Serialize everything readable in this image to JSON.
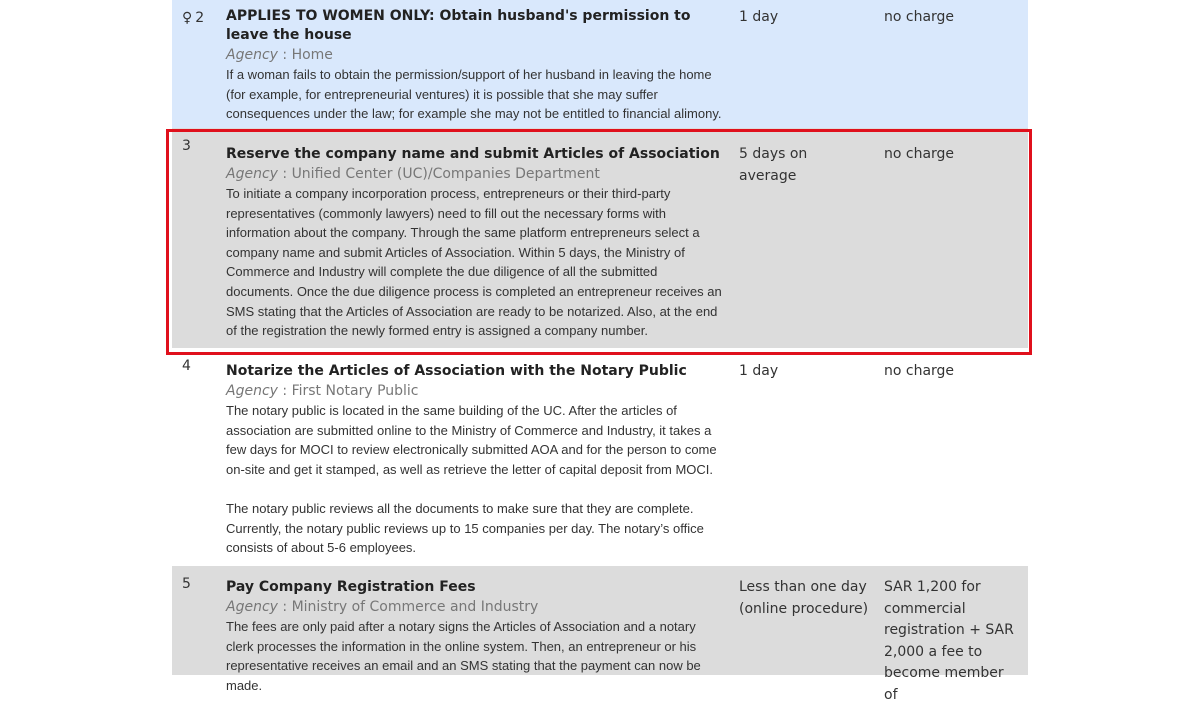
{
  "procedures": [
    {
      "number": "2",
      "women_icon": "♀",
      "title": "APPLIES TO WOMEN ONLY: Obtain husband's permission to leave the house",
      "agency_label": "Agency",
      "agency_sep": " : ",
      "agency": "Home",
      "description": [
        "If a woman fails to obtain the permission/support of her husband in leaving the home (for example, for entrepreneurial ventures) it is possible that she may suffer consequences under the law; for example she may not be entitled to financial alimony."
      ],
      "time": "1 day",
      "cost": "no charge"
    },
    {
      "number": "3",
      "title": "Reserve the company name and submit Articles of Association",
      "agency_label": "Agency",
      "agency_sep": " : ",
      "agency": "Unified Center (UC)/Companies Department",
      "description": [
        "To initiate a company incorporation process, entrepreneurs or their third-party representatives (commonly lawyers) need to fill out the necessary forms with information about the company. Through the same platform entrepreneurs select a company name and submit Articles of Association. Within 5 days, the Ministry of Commerce and Industry will complete the due diligence of all the submitted documents. Once the due diligence process is completed an entrepreneur receives an SMS stating that the Articles of Association are ready to be notarized. Also, at the end of the registration the newly formed entry is assigned a company number."
      ],
      "time": "5 days on average",
      "cost": "no charge"
    },
    {
      "number": "4",
      "title": "Notarize the Articles of Association with the Notary Public",
      "agency_label": "Agency",
      "agency_sep": " : ",
      "agency": "First Notary Public",
      "description": [
        "The notary public is located in the same building of the UC. After the articles of association are submitted online to the Ministry of Commerce and Industry, it takes a few days for MOCI to review electronically submitted AOA and for the person to come on-site and get it stamped, as well as retrieve the letter of capital deposit from MOCI.",
        "The notary public reviews all the documents to make sure that they are complete. Currently, the notary public reviews up to 15 companies per day. The notary’s office consists of about 5-6 employees."
      ],
      "time": "1 day",
      "cost": "no charge"
    },
    {
      "number": "5",
      "title": "Pay Company Registration Fees",
      "agency_label": "Agency",
      "agency_sep": " : ",
      "agency": "Ministry of Commerce and Industry",
      "description": [
        "The fees are only paid after a notary signs the Articles of Association and a notary clerk processes the information in the online system. Then, an entrepreneur or his representative receives an email and an SMS stating that the payment can now be made."
      ],
      "time": "Less than one day (online procedure)",
      "cost": "SAR 1,200 for commercial registration + SAR 2,000 a fee to become member of"
    }
  ],
  "colors": {
    "row_blue": "#d9e8fc",
    "row_gray": "#dcdcdc",
    "highlight_border": "#e0101c"
  }
}
